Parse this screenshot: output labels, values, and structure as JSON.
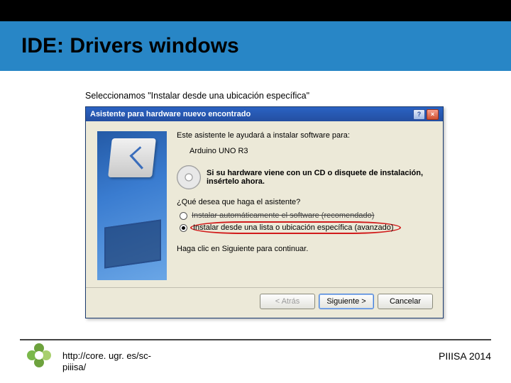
{
  "slide": {
    "title": "IDE: Drivers windows",
    "caption": "Seleccionamos \"Instalar desde una ubicación específica\""
  },
  "wizard": {
    "titlebar": "Asistente para hardware nuevo encontrado",
    "intro": "Este asistente le ayudará a instalar software para:",
    "device": "Arduino UNO R3",
    "cd_hint": "Si su hardware viene con un CD o disquete de instalación, insértelo ahora.",
    "question": "¿Qué desea que haga el asistente?",
    "opt_auto": "Instalar automáticamente el software (recomendado)",
    "opt_manual": "Instalar desde una lista o ubicación específica (avanzado)",
    "continue": "Haga clic en Siguiente para continuar.",
    "buttons": {
      "back": "< Atrás",
      "next": "Siguiente >",
      "cancel": "Cancelar"
    }
  },
  "footer": {
    "url_line1": "http://core. ugr. es/sc-",
    "url_line2": "piiisa/",
    "right": "PIIISA 2014"
  }
}
